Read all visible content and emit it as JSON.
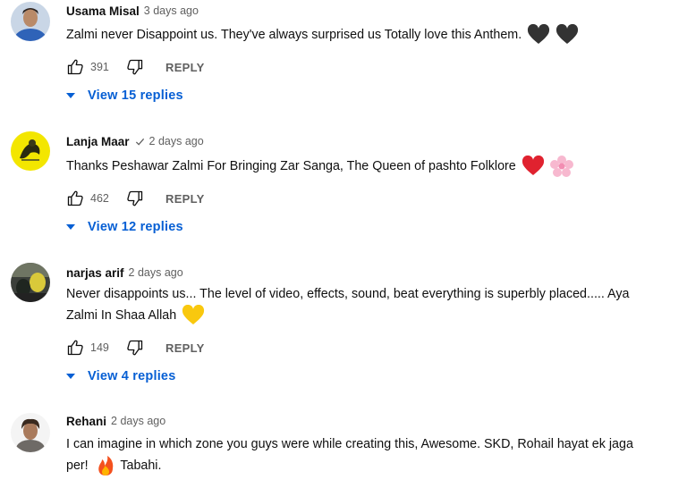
{
  "comments": [
    {
      "author": "Usama Misal",
      "time": "3 days ago",
      "verified": false,
      "text": "Zalmi never Disappoint us. They've always surprised us Totally love this Anthem.",
      "text_line2": "",
      "emojis": [
        "black-heart",
        "black-heart"
      ],
      "likes": "391",
      "reply_label": "REPLY",
      "replies_label": "View 15 replies"
    },
    {
      "author": "Lanja Maar",
      "time": "2 days ago",
      "verified": true,
      "text": "Thanks Peshawar Zalmi For Bringing Zar Sanga, The Queen of pashto Folklore",
      "text_line2": "",
      "emojis": [
        "red-heart",
        "cherry-blossom"
      ],
      "likes": "462",
      "reply_label": "REPLY",
      "replies_label": "View 12 replies"
    },
    {
      "author": "narjas arif",
      "time": "2 days ago",
      "verified": false,
      "text": "Never disappoints us... The level of video, effects, sound, beat everything is superbly placed..... Aya",
      "text_line2": "Zalmi In Shaa Allah",
      "emojis": [
        "yellow-heart"
      ],
      "likes": "149",
      "reply_label": "REPLY",
      "replies_label": "View 4 replies"
    },
    {
      "author": "Rehani",
      "time": "2 days ago",
      "verified": false,
      "text": "I can imagine in which zone you guys were while creating this, Awesome. SKD, Rohail hayat ek jaga",
      "text_line2_before": "per!",
      "text_line2_after": "Tabahi.",
      "emojis": [
        "fire"
      ]
    }
  ],
  "colors": {
    "text": "#0f0f0f",
    "secondary": "#606060",
    "link": "#065fd4"
  }
}
